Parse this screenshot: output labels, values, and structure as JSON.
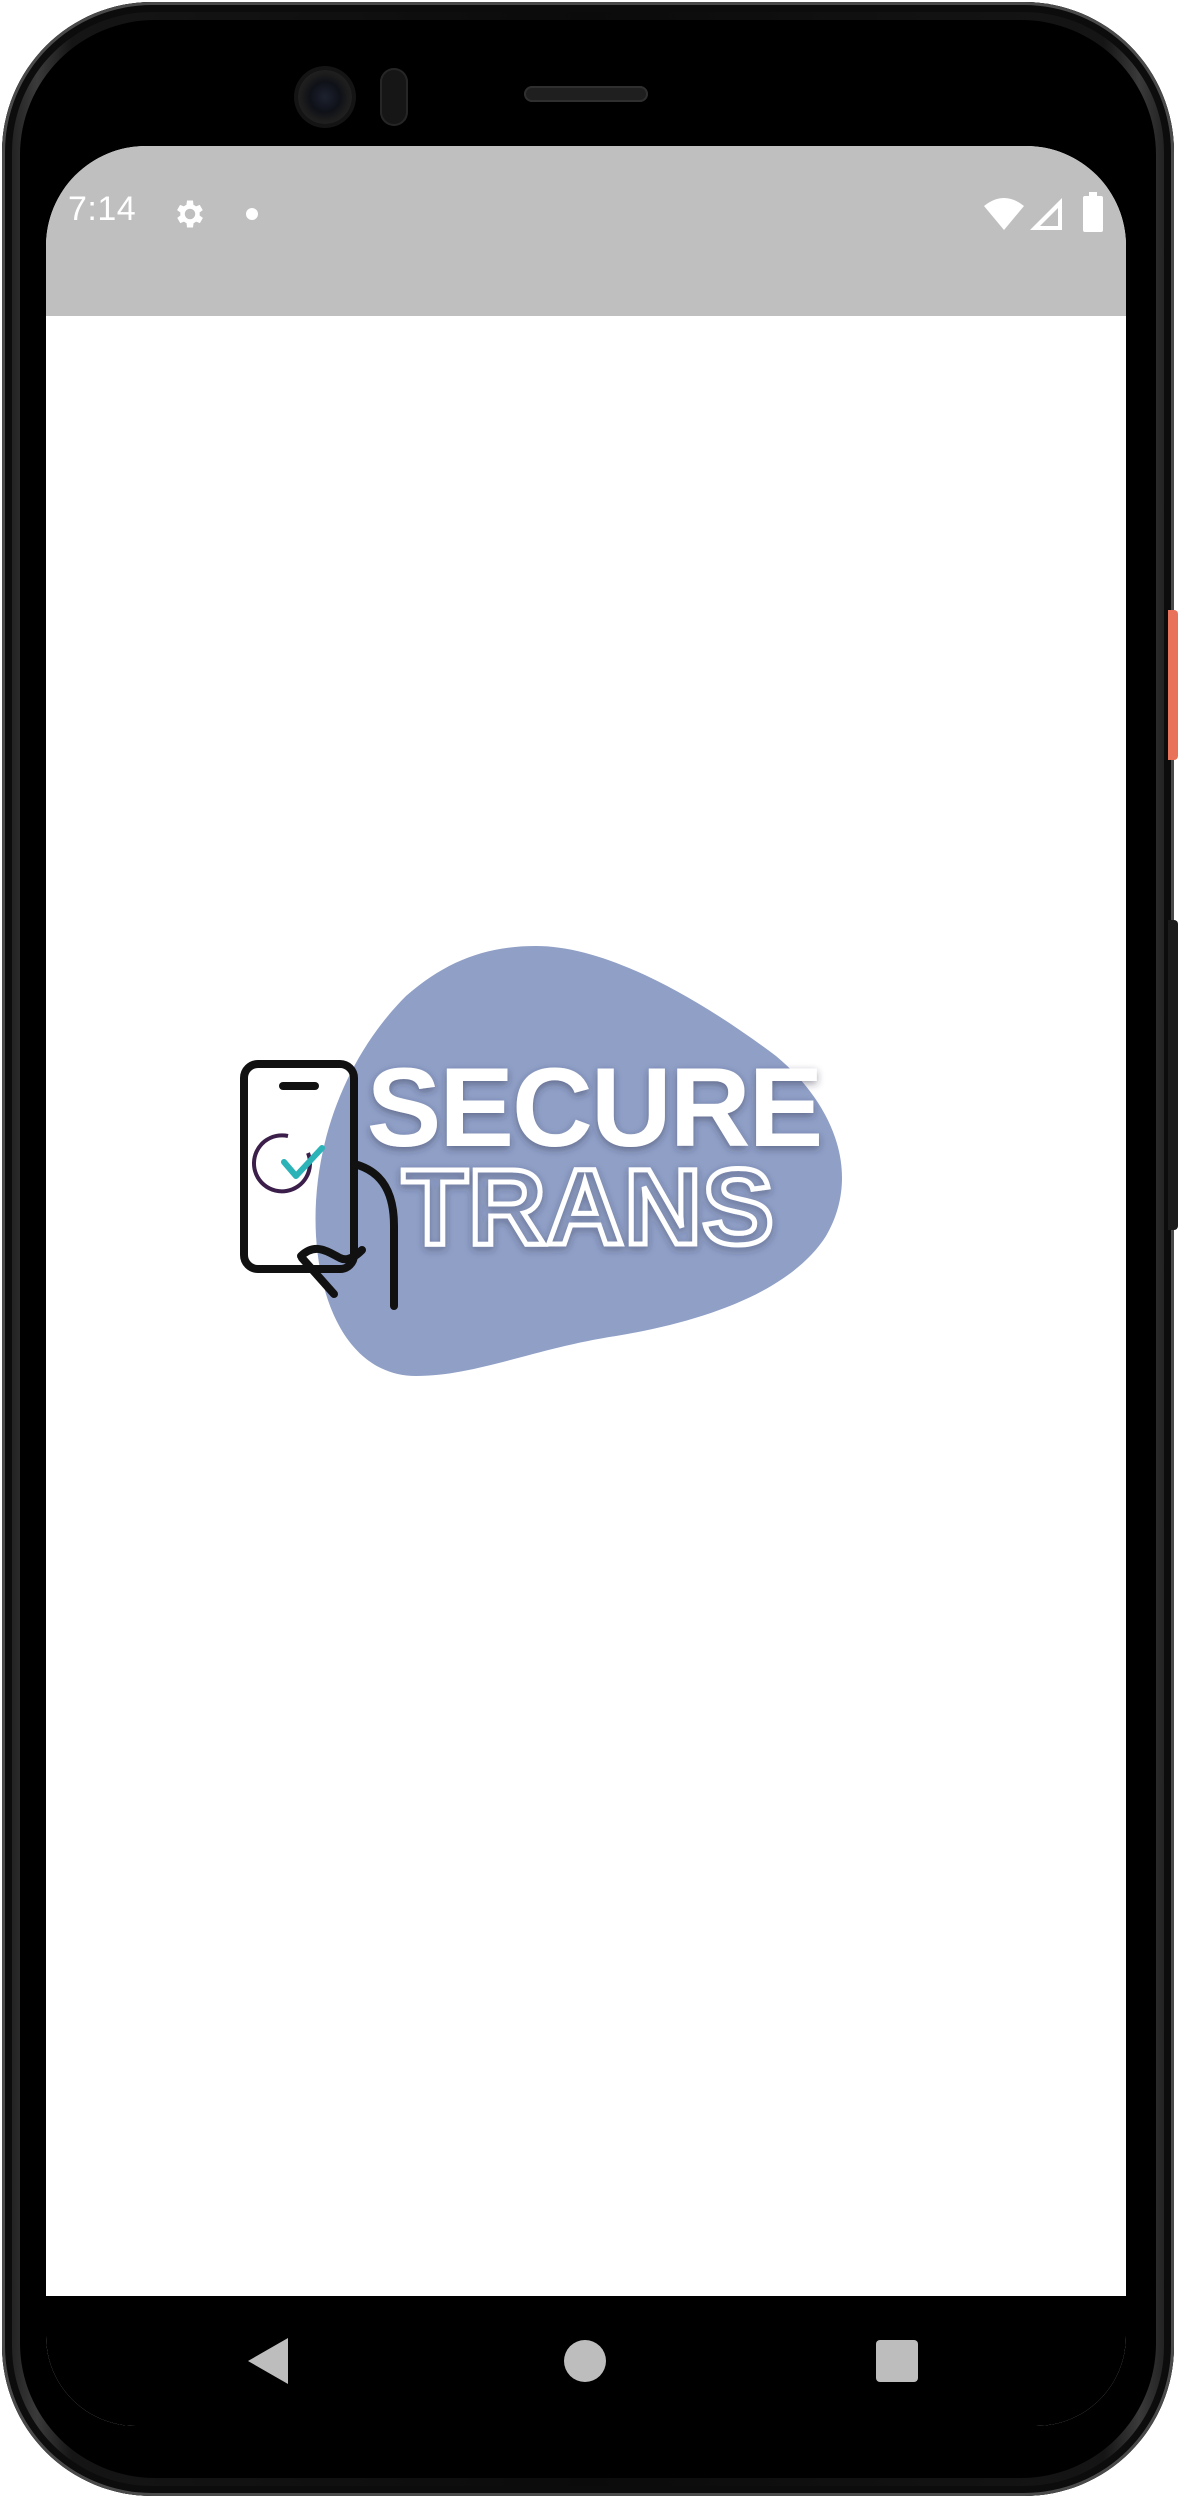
{
  "status_bar": {
    "time": "7:14",
    "icons": [
      "gear-icon",
      "notification-dot-icon",
      "wifi-icon",
      "signal-icon",
      "battery-icon"
    ],
    "background": "#bfbfbf"
  },
  "splash": {
    "logo": {
      "line1": "SECURE",
      "line2": "TRANS",
      "blob_color": "#8f9fc6",
      "icon": "phone-check-hand-icon",
      "check_color": "#2bb3b8",
      "circle_color": "#3b1f4a"
    }
  },
  "nav_bar": {
    "buttons": [
      "back-icon",
      "home-icon",
      "recents-icon"
    ]
  },
  "colors": {
    "screen_background": "#ffffff",
    "nav_background": "#000000"
  }
}
